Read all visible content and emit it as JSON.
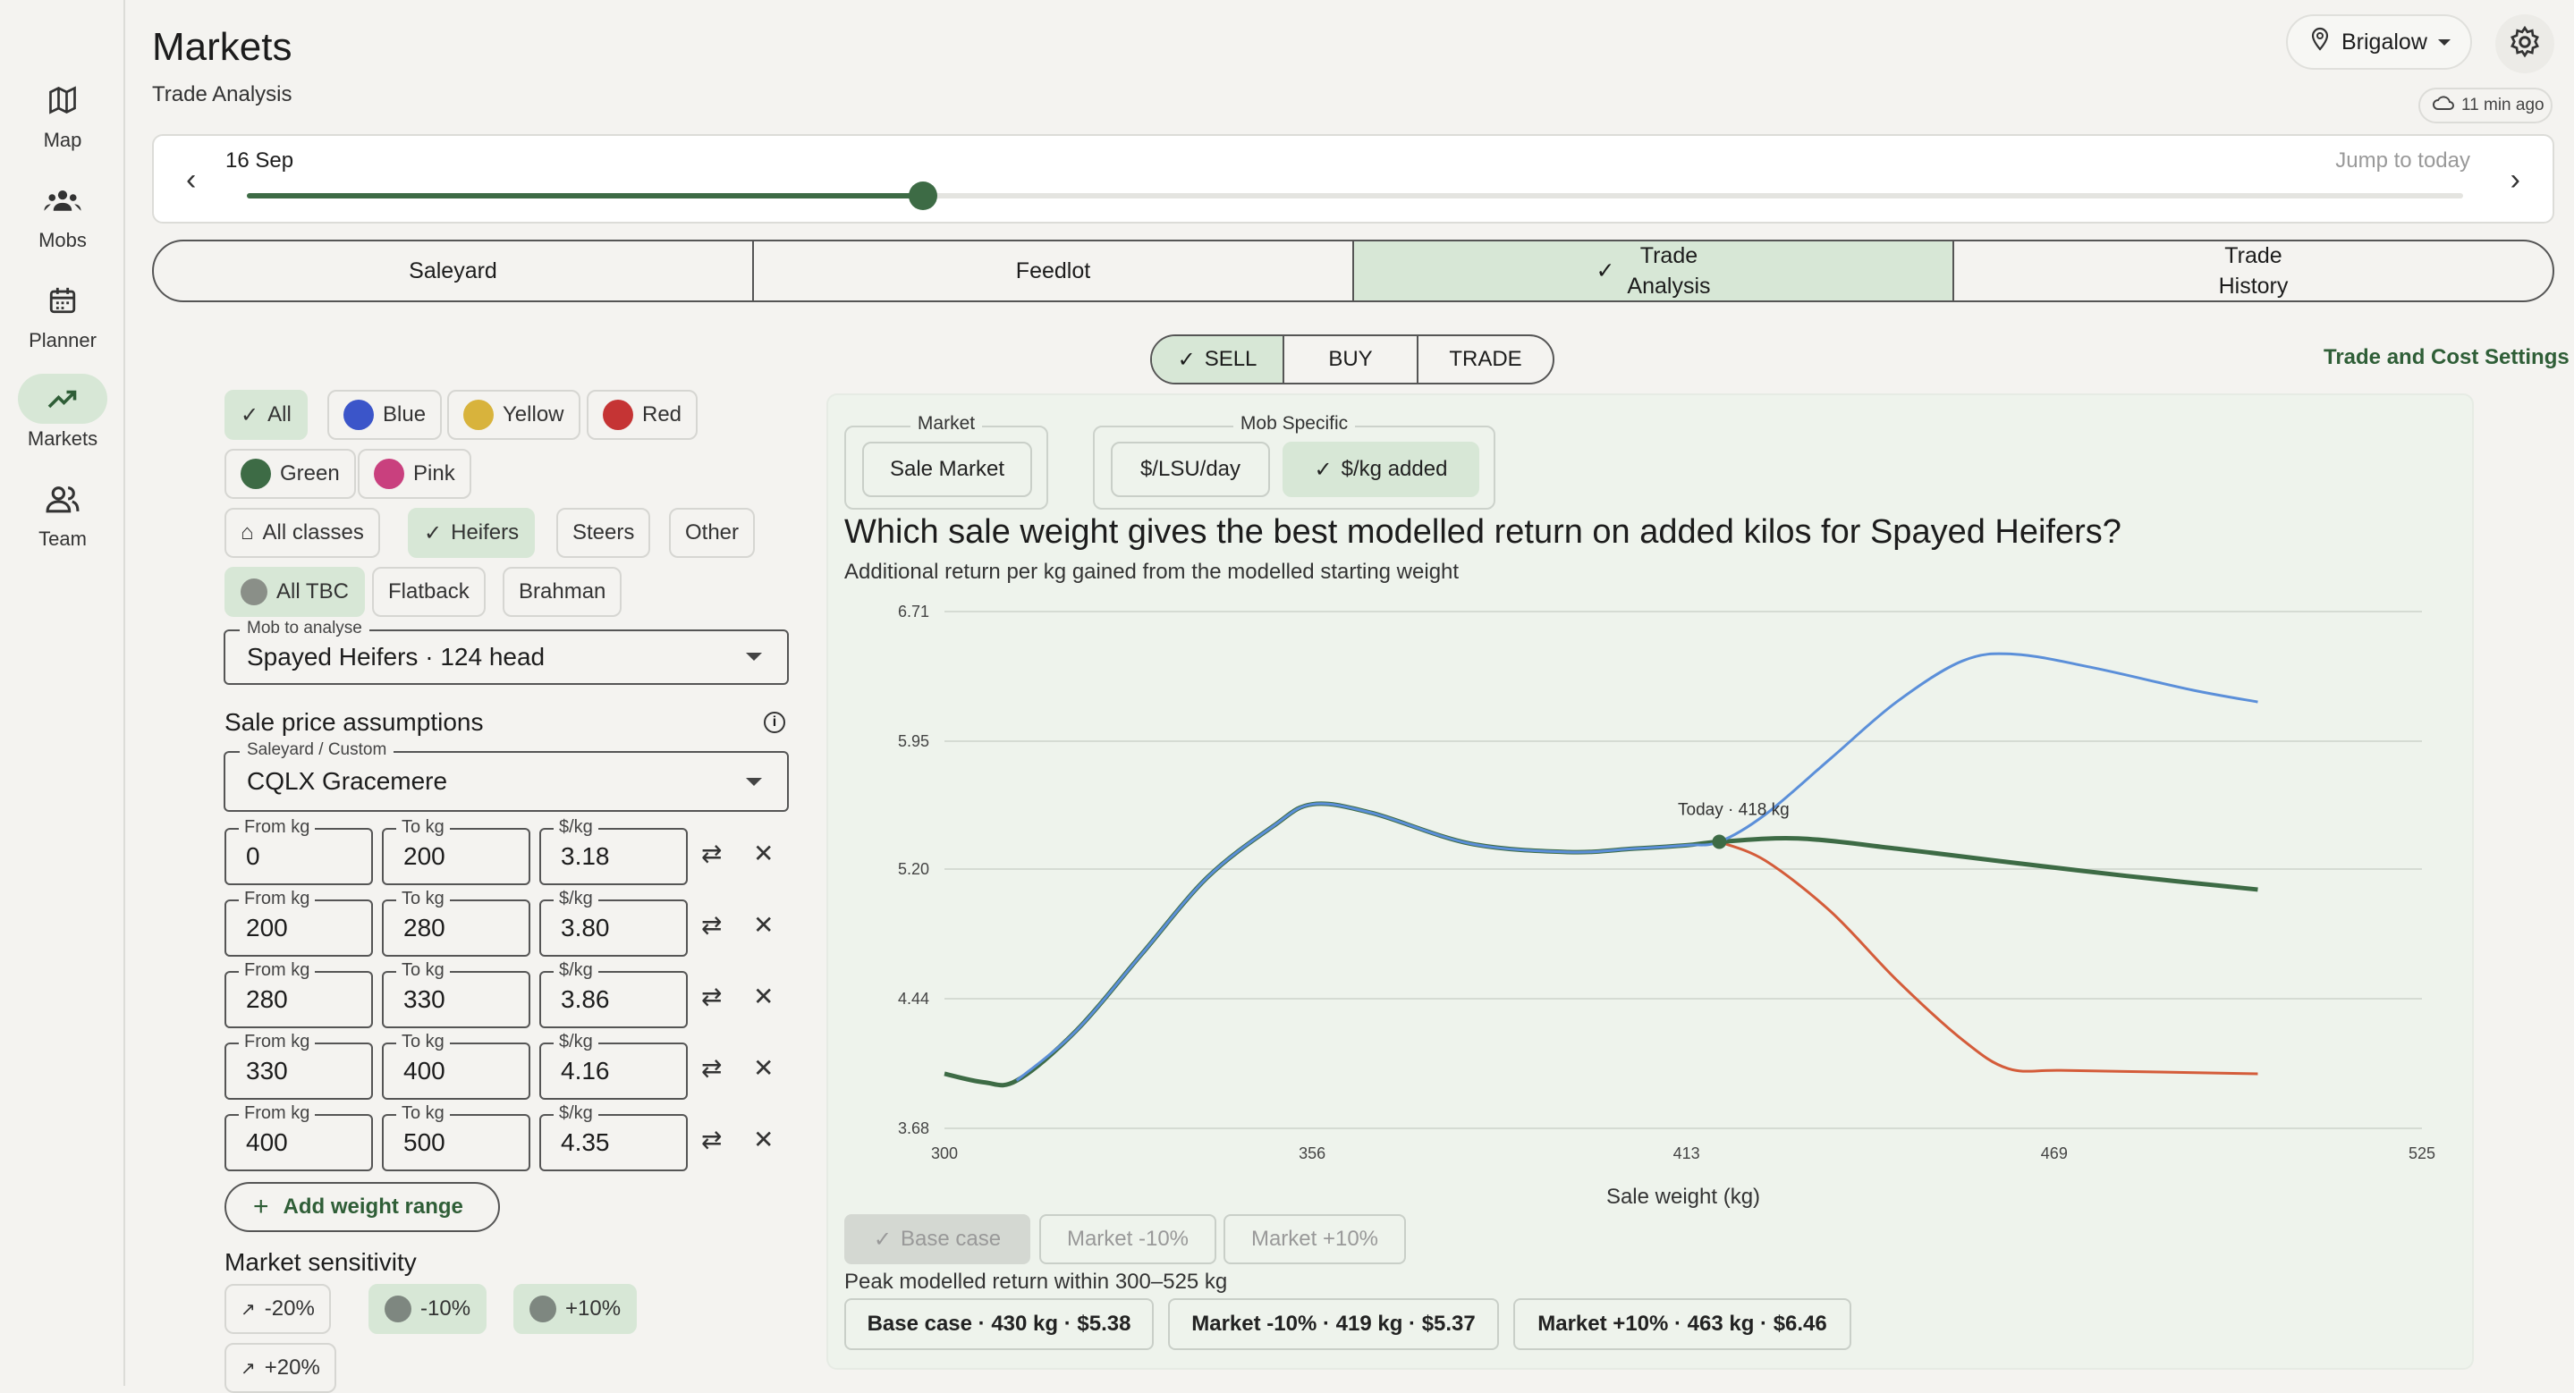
{
  "nav": [
    {
      "label": "Map",
      "icon": "map-icon"
    },
    {
      "label": "Mobs",
      "icon": "groups-icon"
    },
    {
      "label": "Planner",
      "icon": "calendar-icon"
    },
    {
      "label": "Markets",
      "icon": "trending-up-icon",
      "active": true
    },
    {
      "label": "Team",
      "icon": "team-icon"
    }
  ],
  "header": {
    "title": "Markets",
    "subtitle": "Trade Analysis",
    "location": "Brigalow",
    "sync": "11 min ago"
  },
  "timeline": {
    "date": "16 Sep",
    "jump": "Jump to today",
    "progress": 0.305
  },
  "tabs": [
    "Saleyard",
    "Feedlot",
    "Trade\nAnalysis",
    "Trade\nHistory"
  ],
  "mode": {
    "options": [
      "SELL",
      "BUY",
      "TRADE"
    ],
    "selected": "SELL"
  },
  "settings_link": "Trade and Cost Settings",
  "filters": {
    "colours": [
      {
        "label": "All",
        "selected": true
      },
      {
        "label": "Blue",
        "color": "#3b55c9"
      },
      {
        "label": "Yellow",
        "color": "#d8b33c"
      },
      {
        "label": "Red",
        "color": "#c53434"
      },
      {
        "label": "Green",
        "color": "#3d6b45"
      },
      {
        "label": "Pink",
        "color": "#c9407e"
      }
    ],
    "classes": [
      {
        "label": "All classes"
      },
      {
        "label": "Heifers",
        "selected": true
      },
      {
        "label": "Steers"
      },
      {
        "label": "Other"
      }
    ],
    "breeds": [
      {
        "label": "All TBC",
        "selected": true
      },
      {
        "label": "Flatback"
      },
      {
        "label": "Brahman"
      }
    ]
  },
  "mob": {
    "label": "Mob to analyse",
    "value": "Spayed Heifers · 124 head"
  },
  "sale_price": {
    "heading": "Sale price assumptions",
    "saleyard_label": "Saleyard / Custom",
    "saleyard": "CQLX Gracemere",
    "col_labels": {
      "from": "From kg",
      "to": "To kg",
      "price": "$/kg"
    },
    "rows": [
      {
        "from": "0",
        "to": "200",
        "price": "3.18"
      },
      {
        "from": "200",
        "to": "280",
        "price": "3.80"
      },
      {
        "from": "280",
        "to": "330",
        "price": "3.86"
      },
      {
        "from": "330",
        "to": "400",
        "price": "4.16"
      },
      {
        "from": "400",
        "to": "500",
        "price": "4.35"
      }
    ],
    "add_label": "Add weight range"
  },
  "sensitivity": {
    "heading": "Market sensitivity",
    "options": [
      {
        "label": "-20%"
      },
      {
        "label": "-10%",
        "selected": true
      },
      {
        "label": "+10%",
        "selected": true
      },
      {
        "label": "+20%"
      }
    ]
  },
  "panel": {
    "market_group": "Market",
    "market_btn": "Sale Market",
    "mob_group": "Mob Specific",
    "mob_btns": [
      {
        "label": "$/LSU/day"
      },
      {
        "label": "$/kg added",
        "selected": true
      }
    ],
    "question": "Which sale weight gives the best modelled return on added kilos for Spayed Heifers?",
    "subq": "Additional return per kg gained from the modelled starting weight",
    "scenario_pills": [
      {
        "label": "Base case",
        "selected": true
      },
      {
        "label": "Market -10%"
      },
      {
        "label": "Market +10%"
      }
    ],
    "peak_label": "Peak modelled return within 300–525 kg",
    "results": [
      "Base case · 430 kg · $5.38",
      "Market -10% · 419 kg · $5.37",
      "Market +10% · 463 kg · $6.46"
    ]
  },
  "chart_data": {
    "type": "line",
    "xlabel": "Sale weight (kg)",
    "ylabel": "",
    "x_ticks": [
      "300",
      "356",
      "413",
      "469",
      "525"
    ],
    "y_ticks": [
      "6.71",
      "5.95",
      "5.20",
      "4.44",
      "3.68"
    ],
    "xlim": [
      300,
      525
    ],
    "ylim": [
      3.68,
      6.71
    ],
    "annotation": "Today · 418 kg",
    "today": {
      "x": 418,
      "y": 5.36
    },
    "series": [
      {
        "name": "Base case",
        "color": "#3d6b45",
        "x": [
          300,
          306,
          311,
          320,
          330,
          340,
          350,
          356,
          365,
          380,
          395,
          405,
          413,
          418,
          430,
          445,
          460,
          480,
          500
        ],
        "y": [
          4.0,
          3.95,
          3.96,
          4.25,
          4.7,
          5.15,
          5.45,
          5.58,
          5.53,
          5.35,
          5.3,
          5.32,
          5.34,
          5.36,
          5.38,
          5.32,
          5.25,
          5.16,
          5.08
        ]
      },
      {
        "name": "Market +10%",
        "color": "#5b8fd9",
        "x": [
          311,
          320,
          330,
          340,
          350,
          356,
          365,
          380,
          395,
          405,
          413,
          418,
          425,
          435,
          445,
          455,
          463,
          475,
          490,
          500
        ],
        "y": [
          3.96,
          4.25,
          4.7,
          5.15,
          5.45,
          5.58,
          5.53,
          5.35,
          5.3,
          5.32,
          5.34,
          5.36,
          5.52,
          5.85,
          6.18,
          6.42,
          6.46,
          6.38,
          6.25,
          6.18
        ]
      },
      {
        "name": "Market -10%",
        "color": "#d45c3a",
        "x": [
          418,
          425,
          435,
          445,
          455,
          462,
          470,
          485,
          500
        ],
        "y": [
          5.36,
          5.25,
          4.95,
          4.55,
          4.2,
          4.03,
          4.02,
          4.01,
          4.0
        ]
      }
    ]
  }
}
